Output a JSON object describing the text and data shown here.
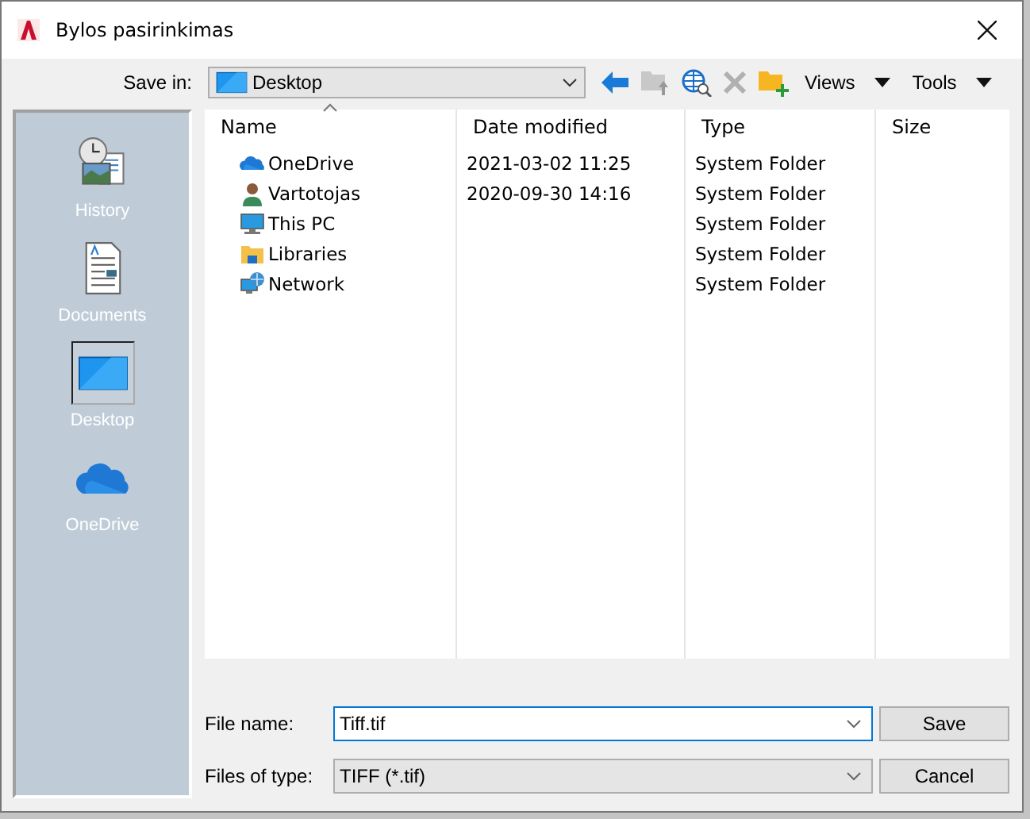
{
  "window": {
    "title": "Bylos pasirinkimas"
  },
  "toolbar": {
    "save_in_label": "Save in:",
    "location": "Desktop",
    "views": "Views",
    "tools": "Tools"
  },
  "places": [
    {
      "kind": "history",
      "label": "History",
      "selected": false
    },
    {
      "kind": "documents",
      "label": "Documents",
      "selected": false
    },
    {
      "kind": "desktop",
      "label": "Desktop",
      "selected": true
    },
    {
      "kind": "onedrive",
      "label": "OneDrive",
      "selected": false
    }
  ],
  "table": {
    "columns": [
      "Name",
      "Date modified",
      "Type",
      "Size"
    ],
    "rows": [
      {
        "kind": "onedrive",
        "name": "OneDrive",
        "date": "2021-03-02 11:25",
        "type": "System Folder"
      },
      {
        "kind": "user",
        "name": "Vartotojas",
        "date": "2020-09-30 14:16",
        "type": "System Folder"
      },
      {
        "kind": "pc",
        "name": "This PC",
        "type": "System Folder"
      },
      {
        "kind": "libraries",
        "name": "Libraries",
        "type": "System Folder"
      },
      {
        "kind": "network",
        "name": "Network",
        "type": "System Folder"
      }
    ]
  },
  "file_name": {
    "label": "File name:",
    "value": "Tiff.tif"
  },
  "file_type": {
    "label": "Files of type:",
    "value": "TIFF (*.tif)"
  },
  "buttons": {
    "save": "Save",
    "cancel": "Cancel"
  }
}
